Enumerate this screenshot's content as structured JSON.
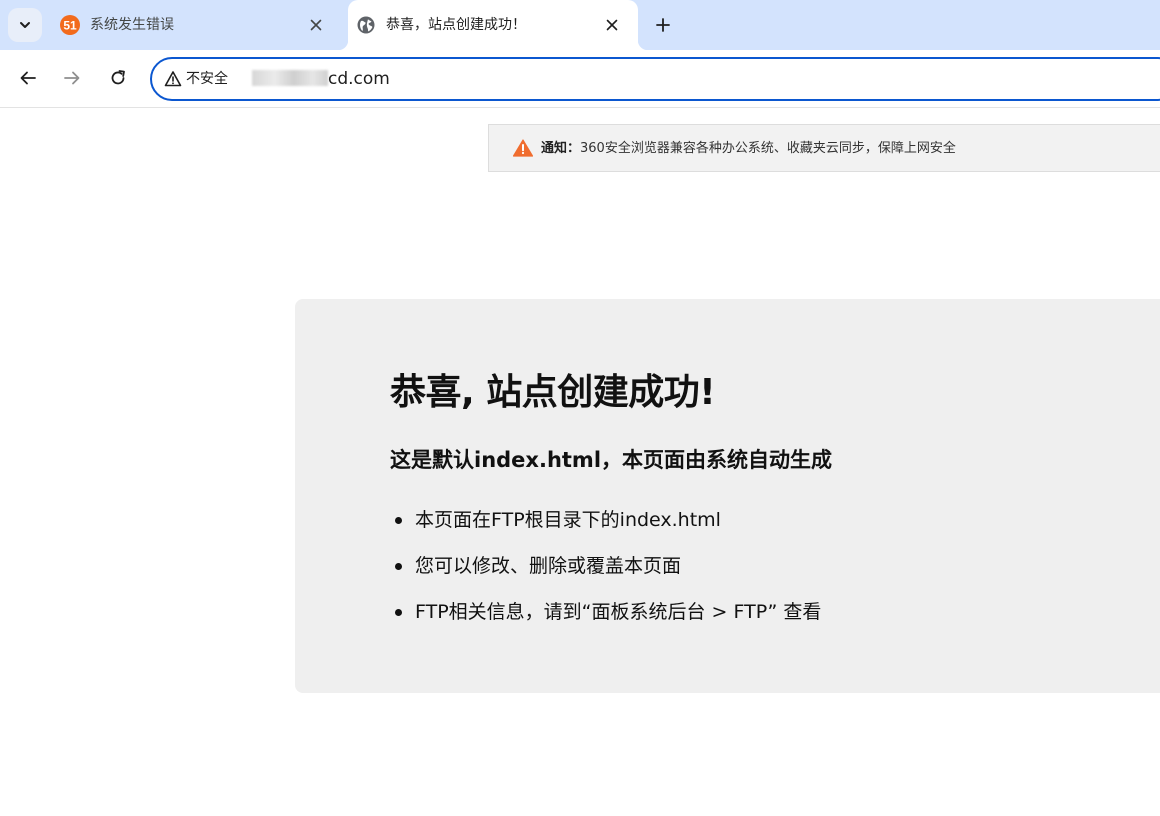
{
  "tabs": [
    {
      "title": "系统发生错误",
      "favicon": "51-logo-icon",
      "active": false
    },
    {
      "title": "恭喜，站点创建成功！",
      "favicon": "globe-icon",
      "active": true
    }
  ],
  "toolbar": {
    "security_label": "不安全",
    "url_visible": "cd.com"
  },
  "notice": {
    "label": "通知：",
    "text": "360安全浏览器兼容各种办公系统、收藏夹云同步，保障上网安全",
    "icon": "warning-triangle-icon"
  },
  "page": {
    "heading": "恭喜, 站点创建成功!",
    "subheading": "这是默认index.html，本页面由系统自动生成",
    "items": [
      "本页面在FTP根目录下的index.html",
      "您可以修改、删除或覆盖本页面",
      "FTP相关信息，请到“面板系统后台 > FTP” 查看"
    ]
  },
  "colors": {
    "tabstrip_bg": "#d3e3fd",
    "omnibox_border": "#0b57d0",
    "notice_icon": "#f06d2f",
    "favicon_51": "#f26b1d",
    "panel_bg": "#efefef"
  }
}
